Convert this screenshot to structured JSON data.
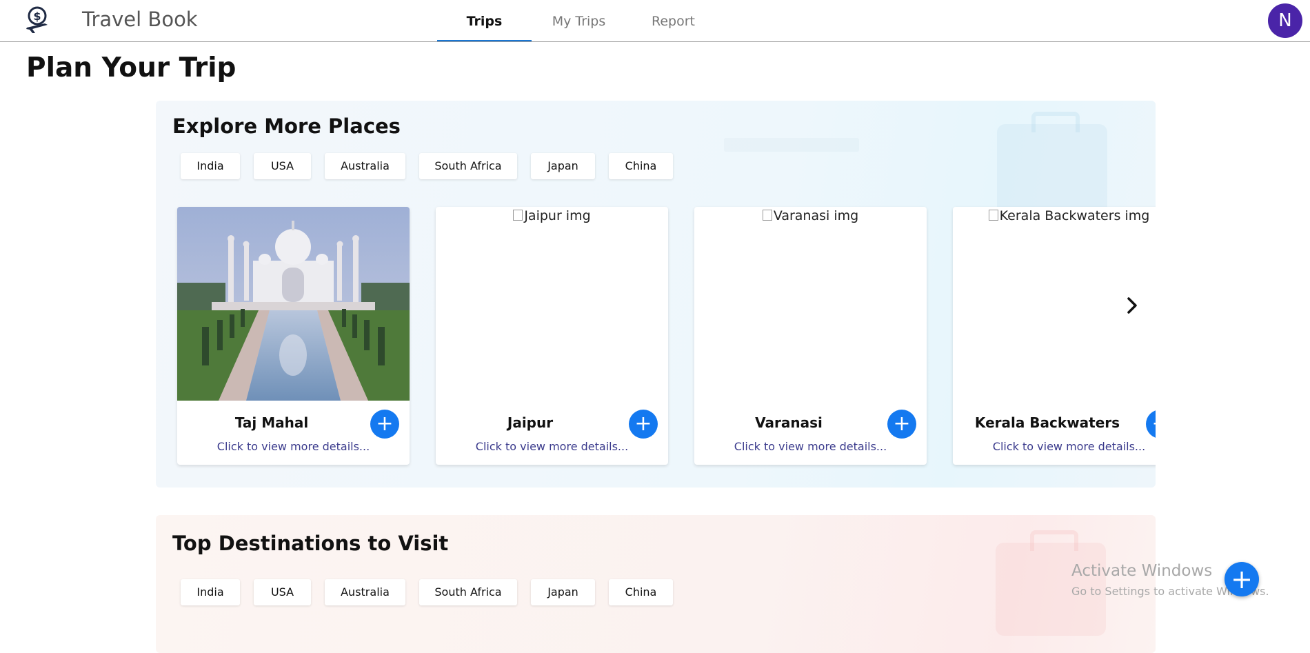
{
  "header": {
    "app_title": "Travel Book",
    "tabs": [
      {
        "label": "Trips",
        "active": true
      },
      {
        "label": "My Trips",
        "active": false
      },
      {
        "label": "Report",
        "active": false
      }
    ],
    "avatar_initial": "N",
    "avatar_color": "#4a24a8",
    "accent_color": "#1976d2"
  },
  "page_title": "Plan Your Trip",
  "explore": {
    "title": "Explore More Places",
    "countries": [
      "India",
      "USA",
      "Australia",
      "South Africa",
      "Japan",
      "China"
    ],
    "cards": [
      {
        "name": "Taj Mahal",
        "image_alt": "Taj Mahal img",
        "image_loaded": true,
        "link": "Click to view more details..."
      },
      {
        "name": "Jaipur",
        "image_alt": "Jaipur img",
        "image_loaded": false,
        "link": "Click to view more details..."
      },
      {
        "name": "Varanasi",
        "image_alt": "Varanasi img",
        "image_loaded": false,
        "link": "Click to view more details..."
      },
      {
        "name": "Kerala Backwaters",
        "image_alt": "Kerala Backwaters img",
        "image_loaded": false,
        "link": "Click to view more details..."
      }
    ],
    "next_icon": "chevron-right-icon"
  },
  "top_destinations": {
    "title": "Top Destinations to Visit",
    "countries": [
      "India",
      "USA",
      "Australia",
      "South Africa",
      "Japan",
      "China"
    ]
  },
  "watermark": {
    "title": "Activate Windows",
    "subtitle": "Go to Settings to activate Windows."
  },
  "fab_icon": "plus-icon",
  "button_color": "#1479f0"
}
